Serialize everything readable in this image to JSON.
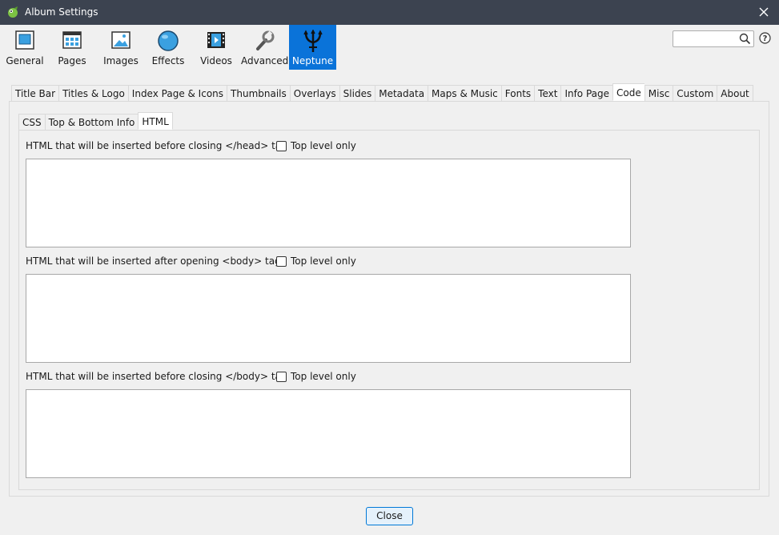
{
  "window": {
    "title": "Album Settings"
  },
  "toolbar": {
    "items": [
      {
        "label": "General"
      },
      {
        "label": "Pages"
      },
      {
        "label": "Images"
      },
      {
        "label": "Effects"
      },
      {
        "label": "Videos"
      },
      {
        "label": "Advanced"
      },
      {
        "label": "Neptune"
      }
    ],
    "active": "Neptune"
  },
  "search": {
    "value": "",
    "placeholder": ""
  },
  "help": {
    "icon": "help-icon"
  },
  "tabs": [
    "Title Bar",
    "Titles & Logo",
    "Index Page & Icons",
    "Thumbnails",
    "Overlays",
    "Slides",
    "Metadata",
    "Maps & Music",
    "Fonts",
    "Text",
    "Info Page",
    "Code",
    "Misc",
    "Custom",
    "About"
  ],
  "active_tab": "Code",
  "subtabs": [
    "CSS",
    "Top & Bottom Info",
    "HTML"
  ],
  "active_subtab": "HTML",
  "sections": [
    {
      "label": "HTML that will be inserted before closing </head> tag",
      "checkbox": "Top level only",
      "checked": false,
      "value": ""
    },
    {
      "label": "HTML that will be inserted after opening <body> tag",
      "checkbox": "Top level only",
      "checked": false,
      "value": ""
    },
    {
      "label": "HTML that will be inserted before closing </body> tag",
      "checkbox": "Top level only",
      "checked": false,
      "value": ""
    }
  ],
  "footer": {
    "close_label": "Close"
  },
  "colors": {
    "titlebar": "#3c4350",
    "accent": "#0a73d9"
  }
}
